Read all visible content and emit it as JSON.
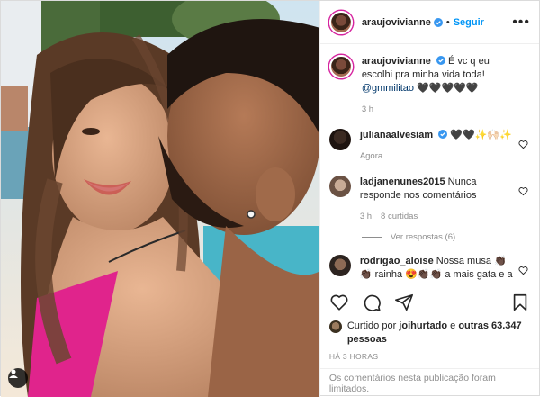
{
  "post": {
    "author": "araujovivianne",
    "separator": "•",
    "follow_label": "Seguir",
    "more_label": "•••"
  },
  "caption": {
    "username": "araujovivianne",
    "text": "É vc q eu escolhi pra minha vida toda!",
    "mention": "@gmmilitao",
    "emoji": "🖤🖤🖤🖤🖤",
    "time": "3 h"
  },
  "comments": [
    {
      "username": "julianaalvesiam",
      "text": "🖤🖤✨🙌🏻✨",
      "time": "Agora",
      "likes": ""
    },
    {
      "username": "ladjanenunes2015",
      "text": "Nunca responde nos comentários",
      "time": "3 h",
      "likes": "8 curtidas"
    },
    {
      "username": "rodrigao_aloise",
      "text": "Nossa musa 👏🏿👏🏿 rainha 😍👏🏿👏🏿 a mais gata e a",
      "time": "",
      "likes": ""
    }
  ],
  "replies_label": "Ver respostas (6)",
  "likes": {
    "prefix": "Curtido por",
    "user": "joihurtado",
    "connector": "e",
    "others": "outras 63.347 pessoas"
  },
  "timestamp": "HÁ 3 HORAS",
  "comments_limited": "Os comentários nesta publicação foram limitados.",
  "colors": {
    "accent": "#0095f6",
    "verified": "#3897f0",
    "border": "#dbdbdb"
  }
}
